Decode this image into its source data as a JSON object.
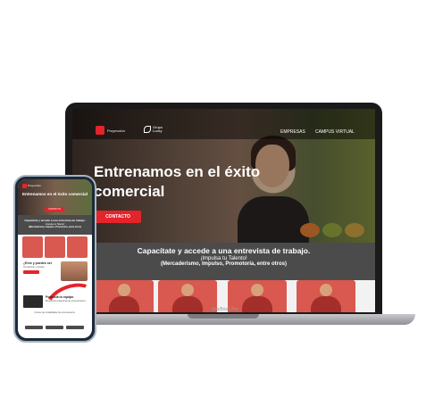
{
  "desktop": {
    "brand_left": "Proyección",
    "brand_right": "Grupo\nLucky",
    "nav": [
      "EMPRESAS",
      "CAMPUS VIRTUAL"
    ],
    "hero_title": "Entrenamos en el éxito comercial",
    "cta": "CONTACTO",
    "info_title": "Capacítate y accede a una entrevista de trabajo.",
    "info_sub1": "¡Impulsa tu Talento!",
    "info_sub2": "(Mercaderismo, Impulso, Promotoría, entre otros)",
    "device_label": "MacBook Pro"
  },
  "mobile": {
    "brand": "Proyección",
    "hero_title": "Entrenamos en el éxito comercial",
    "cta": "CONTACTO",
    "band_title": "Capacítate y accede a una entrevista de trabajo.",
    "band_sub1": "¡Impulsa tu Talento!",
    "band_sub2": "(Mercaderismo, Impulso, Promotoría, entre otros)",
    "section_title": "¿Eres y puedes ser",
    "section_text": "Conviértete y postula",
    "section2_title": "Potencia tu equipo",
    "section2_text": "Brindamos programas de entrenamiento.",
    "footer_text": "Conoce las modalidades de entrenamiento."
  },
  "colors": {
    "accent": "#e4242b",
    "band": "#4b4b4b"
  }
}
